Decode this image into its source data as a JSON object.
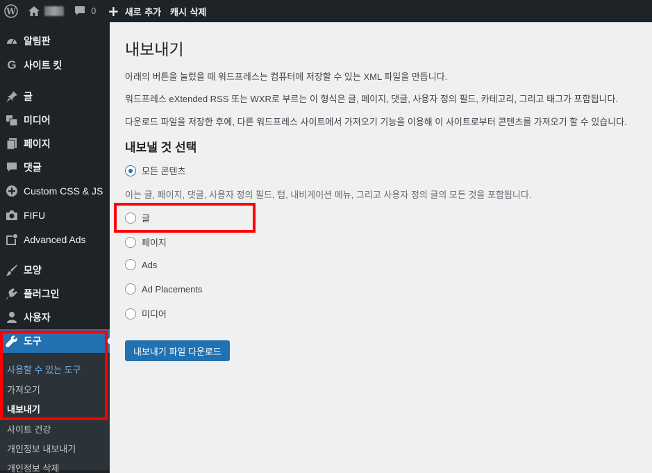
{
  "adminbar": {
    "comment_count": "0",
    "new_label": "새로 추가",
    "cache_label": "캐시 삭제"
  },
  "sidebar": {
    "items": [
      {
        "label": "알림판",
        "icon": "dashboard-icon"
      },
      {
        "label": "사이트 킷",
        "icon": "g-icon"
      },
      {
        "label": "글",
        "icon": "pin-icon"
      },
      {
        "label": "미디어",
        "icon": "media-icon"
      },
      {
        "label": "페이지",
        "icon": "page-icon"
      },
      {
        "label": "댓글",
        "icon": "comment-icon"
      },
      {
        "label": "Custom CSS & JS",
        "icon": "plus-circle-icon"
      },
      {
        "label": "FIFU",
        "icon": "camera-icon"
      },
      {
        "label": "Advanced Ads",
        "icon": "ads-icon"
      },
      {
        "label": "모양",
        "icon": "brush-icon"
      },
      {
        "label": "플러그인",
        "icon": "plugin-icon"
      },
      {
        "label": "사용자",
        "icon": "user-icon"
      },
      {
        "label": "도구",
        "icon": "wrench-icon"
      }
    ],
    "submenu": [
      "사용할 수 있는 도구",
      "가져오기",
      "내보내기",
      "사이트 건강",
      "개인정보 내보내기",
      "개인정보 삭제"
    ]
  },
  "main": {
    "title": "내보내기",
    "desc1": "아래의 버튼을 눌렀을 때 워드프레스는 컴퓨터에 저장할 수 있는 XML 파일을 만듭니다.",
    "desc2": "워드프레스 eXtended RSS 또는 WXR로 부르는 이 형식은 글, 페이지, 댓글, 사용자 정의 필드, 카테고리, 그리고 태그가 포함됩니다.",
    "desc3": "다운로드 파일을 저장한 후에, 다른 워드프레스 사이트에서 가져오기 기능을 이용해 이 사이트로부터 콘텐츠를 가져오기 할 수 있습니다.",
    "section_title": "내보낼 것 선택",
    "options": [
      "모든 콘텐츠",
      "글",
      "페이지",
      "Ads",
      "Ad Placements",
      "미디어"
    ],
    "selected_option": "모든 콘텐츠",
    "help": "이는 글, 페이지, 댓글, 사용자 정의 필드, 텀, 내비게이션 메뉴, 그리고 사용자 정의 글의 모든 것을 포함됩니다.",
    "download_button": "내보내기 파일 다운로드"
  },
  "colors": {
    "sidebar_bg": "#1d2327",
    "accent": "#2271b1",
    "highlight": "#ff0000"
  }
}
